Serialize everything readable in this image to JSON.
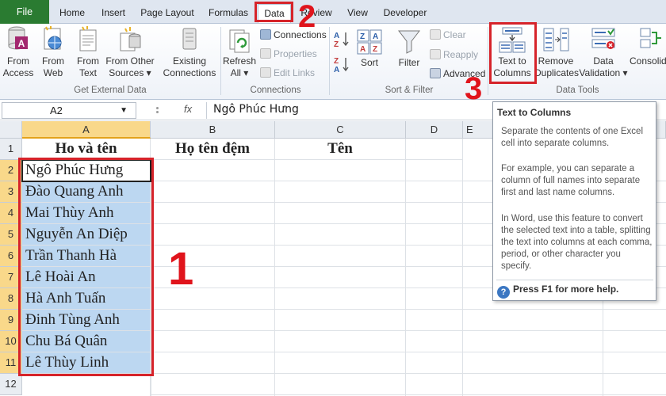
{
  "tabs": [
    {
      "label": "File"
    },
    {
      "label": "Home"
    },
    {
      "label": "Insert"
    },
    {
      "label": "Page Layout"
    },
    {
      "label": "Formulas"
    },
    {
      "label": "Data"
    },
    {
      "label": "Review"
    },
    {
      "label": "View"
    },
    {
      "label": "Developer"
    }
  ],
  "ribbon": {
    "get_external": {
      "from_access": [
        "From",
        "Access"
      ],
      "from_web": [
        "From",
        "Web"
      ],
      "from_text": [
        "From",
        "Text"
      ],
      "from_other": [
        "From Other",
        "Sources ▾"
      ],
      "existing": [
        "Existing",
        "Connections"
      ],
      "group_label": "Get External Data"
    },
    "connections": {
      "refresh": [
        "Refresh",
        "All ▾"
      ],
      "connections": "Connections",
      "properties": "Properties",
      "edit_links": "Edit Links",
      "group_label": "Connections"
    },
    "sort_filter": {
      "sort": "Sort",
      "filter": "Filter",
      "clear": "Clear",
      "reapply": "Reapply",
      "advanced": "Advanced",
      "group_label": "Sort & Filter"
    },
    "data_tools": {
      "text_to_columns": [
        "Text to",
        "Columns"
      ],
      "remove_duplicates": [
        "Remove",
        "Duplicates"
      ],
      "data_validation": [
        "Data",
        "Validation ▾"
      ],
      "consolidate": "Consolid",
      "group_label": "Data Tools"
    }
  },
  "formula_bar": {
    "name_box": "A2",
    "fx": "fx",
    "formula": "Ngô Phúc Hưng"
  },
  "grid": {
    "columns": [
      "A",
      "B",
      "C",
      "D",
      "E"
    ],
    "rows": [
      "1",
      "2",
      "3",
      "4",
      "5",
      "6",
      "7",
      "8",
      "9",
      "10",
      "11",
      "12"
    ],
    "headers": {
      "a": "Ho và tên",
      "b": "Họ tên đệm",
      "c": "Tên"
    },
    "names": [
      "Ngô Phúc Hưng",
      "Đào Quang Anh",
      "Mai Thùy Anh",
      "Nguyễn An Diệp",
      "Trần Thanh Hà",
      "Lê Hoài An",
      "Hà Anh Tuấn",
      "Đinh Tùng Anh",
      "Chu Bá Quân",
      "Lê Thùy Linh"
    ]
  },
  "annotations": {
    "step1": "1",
    "step2": "2",
    "step3": "3"
  },
  "tooltip": {
    "title": "Text to Columns",
    "p1": "Separate the contents of one Excel cell into separate columns.",
    "p2": "For example, you can separate a column of full names into separate first and last name columns.",
    "p3": "In Word, use this feature to convert the selected text into a table, splitting the text into columns at each comma, period, or other character you specify.",
    "help": "Press F1 for more help."
  },
  "colors": {
    "file_tab": "#2a7b31",
    "selection": "#bcd7f1",
    "annotation": "#d6232a",
    "header_highlight": "#f9d88a"
  }
}
